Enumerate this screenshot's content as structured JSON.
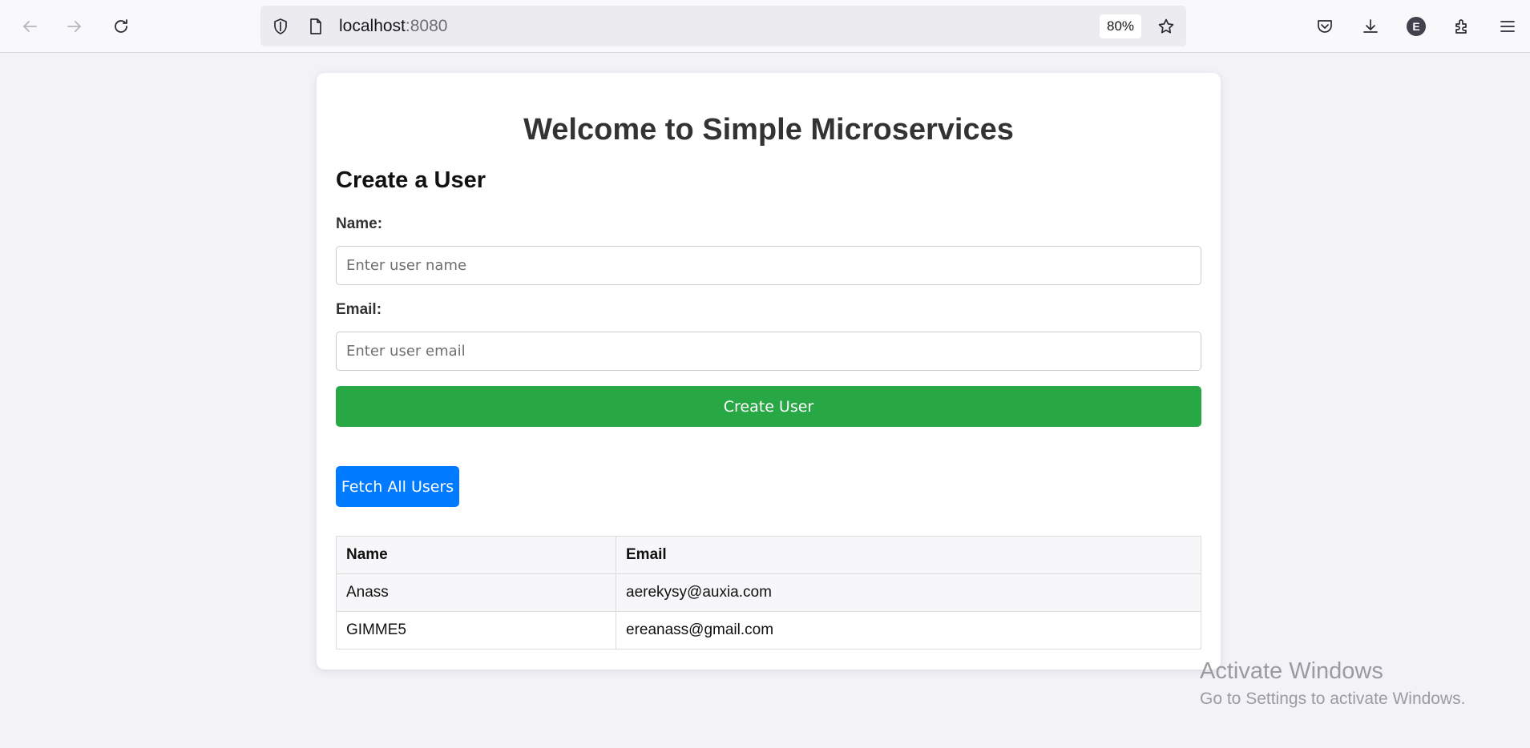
{
  "browser": {
    "url_host": "localhost",
    "url_port": ":8080",
    "zoom_level": "80%",
    "account_initial": "E"
  },
  "page": {
    "title": "Welcome to Simple Microservices",
    "create_section_title": "Create a User",
    "name_label": "Name:",
    "name_placeholder": "Enter user name",
    "email_label": "Email:",
    "email_placeholder": "Enter user email",
    "create_button_label": "Create User",
    "fetch_button_label": "Fetch All Users"
  },
  "table": {
    "headers": [
      "Name",
      "Email"
    ],
    "rows": [
      [
        "Anass",
        "aerekysy@auxia.com"
      ],
      [
        "GIMME5",
        "ereanass@gmail.com"
      ]
    ]
  },
  "watermark": {
    "title": "Activate Windows",
    "subtitle": "Go to Settings to activate Windows."
  },
  "colors": {
    "create_button": "#28a745",
    "fetch_button": "#007bff",
    "page_background": "#f3f3f7"
  },
  "icons": [
    "back-arrow-icon",
    "forward-arrow-icon",
    "reload-icon",
    "shield-icon",
    "page-icon",
    "star-icon",
    "pocket-icon",
    "download-icon",
    "account-icon",
    "extensions-icon",
    "menu-icon"
  ]
}
